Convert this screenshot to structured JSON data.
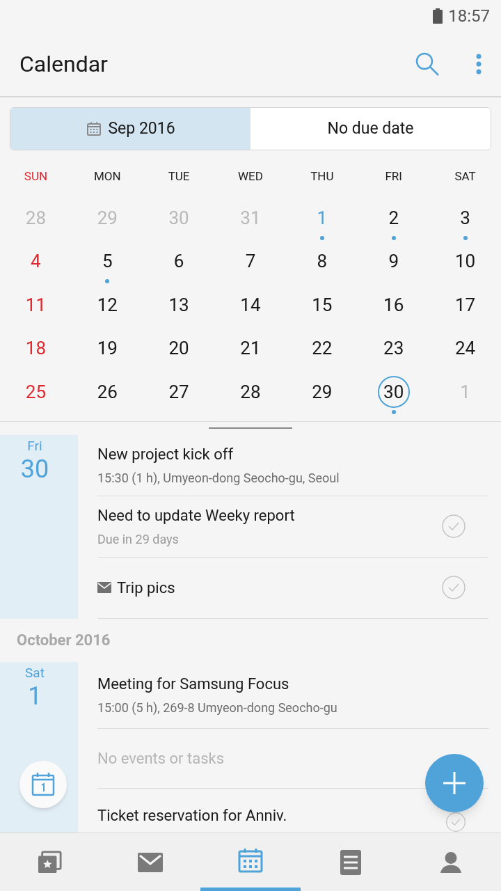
{
  "status_bar": {
    "time": "18:57"
  },
  "app_bar": {
    "title": "Calendar"
  },
  "tabs": [
    {
      "label": "Sep 2016",
      "selected": true
    },
    {
      "label": "No due date",
      "selected": false
    }
  ],
  "weekdays": [
    "SUN",
    "MON",
    "TUE",
    "WED",
    "THU",
    "FRI",
    "SAT"
  ],
  "weeks": [
    [
      {
        "day": "28",
        "other_month": true,
        "has_event": false,
        "selected": false
      },
      {
        "day": "29",
        "other_month": true,
        "has_event": false,
        "selected": false
      },
      {
        "day": "30",
        "other_month": true,
        "has_event": false,
        "selected": false
      },
      {
        "day": "31",
        "other_month": true,
        "has_event": false,
        "selected": false
      },
      {
        "day": "1",
        "other_month": false,
        "has_event": true,
        "selected": false,
        "today": true
      },
      {
        "day": "2",
        "other_month": false,
        "has_event": true,
        "selected": false
      },
      {
        "day": "3",
        "other_month": false,
        "has_event": true,
        "selected": false
      }
    ],
    [
      {
        "day": "4",
        "other_month": false,
        "has_event": false,
        "selected": false
      },
      {
        "day": "5",
        "other_month": false,
        "has_event": true,
        "selected": false
      },
      {
        "day": "6",
        "other_month": false,
        "has_event": false,
        "selected": false
      },
      {
        "day": "7",
        "other_month": false,
        "has_event": false,
        "selected": false
      },
      {
        "day": "8",
        "other_month": false,
        "has_event": false,
        "selected": false
      },
      {
        "day": "9",
        "other_month": false,
        "has_event": false,
        "selected": false
      },
      {
        "day": "10",
        "other_month": false,
        "has_event": false,
        "selected": false
      }
    ],
    [
      {
        "day": "11",
        "other_month": false,
        "has_event": false,
        "selected": false
      },
      {
        "day": "12",
        "other_month": false,
        "has_event": false,
        "selected": false
      },
      {
        "day": "13",
        "other_month": false,
        "has_event": false,
        "selected": false
      },
      {
        "day": "14",
        "other_month": false,
        "has_event": false,
        "selected": false
      },
      {
        "day": "15",
        "other_month": false,
        "has_event": false,
        "selected": false
      },
      {
        "day": "16",
        "other_month": false,
        "has_event": false,
        "selected": false
      },
      {
        "day": "17",
        "other_month": false,
        "has_event": false,
        "selected": false
      }
    ],
    [
      {
        "day": "18",
        "other_month": false,
        "has_event": false,
        "selected": false
      },
      {
        "day": "19",
        "other_month": false,
        "has_event": false,
        "selected": false
      },
      {
        "day": "20",
        "other_month": false,
        "has_event": false,
        "selected": false
      },
      {
        "day": "21",
        "other_month": false,
        "has_event": false,
        "selected": false
      },
      {
        "day": "22",
        "other_month": false,
        "has_event": false,
        "selected": false
      },
      {
        "day": "23",
        "other_month": false,
        "has_event": false,
        "selected": false
      },
      {
        "day": "24",
        "other_month": false,
        "has_event": false,
        "selected": false
      }
    ],
    [
      {
        "day": "25",
        "other_month": false,
        "has_event": false,
        "selected": false
      },
      {
        "day": "26",
        "other_month": false,
        "has_event": false,
        "selected": false
      },
      {
        "day": "27",
        "other_month": false,
        "has_event": false,
        "selected": false
      },
      {
        "day": "28",
        "other_month": false,
        "has_event": false,
        "selected": false
      },
      {
        "day": "29",
        "other_month": false,
        "has_event": false,
        "selected": false
      },
      {
        "day": "30",
        "other_month": false,
        "has_event": true,
        "selected": true
      },
      {
        "day": "1",
        "other_month": true,
        "has_event": false,
        "selected": false
      }
    ]
  ],
  "agenda": [
    {
      "kind": "day",
      "weekday": "Fri",
      "date": "30",
      "items": [
        {
          "kind": "event",
          "title": "New project kick off",
          "detail": "15:30 (1 h), Umyeon-dong Seocho-gu, Seoul"
        },
        {
          "kind": "task",
          "title": "Need to update Weeky report",
          "detail": "Due in 29 days",
          "checked": false
        },
        {
          "kind": "mail_task",
          "title": "Trip pics",
          "checked": false
        }
      ]
    },
    {
      "kind": "month",
      "title": "October 2016"
    },
    {
      "kind": "day",
      "weekday": "Sat",
      "date": "1",
      "items": [
        {
          "kind": "event",
          "title": "Meeting for Samsung Focus",
          "detail": "15:00 (5 h), 269-8 Umyeon-dong Seocho-gu"
        }
      ]
    },
    {
      "kind": "day",
      "items": [
        {
          "kind": "empty",
          "title": "No events or tasks"
        }
      ]
    },
    {
      "kind": "day",
      "items": [
        {
          "kind": "task",
          "title": "Ticket reservation for Anniv.",
          "checked": false
        }
      ]
    }
  ],
  "bottom_nav": [
    {
      "selected": false
    },
    {
      "selected": false
    },
    {
      "selected": true
    },
    {
      "selected": false
    },
    {
      "selected": false
    }
  ]
}
